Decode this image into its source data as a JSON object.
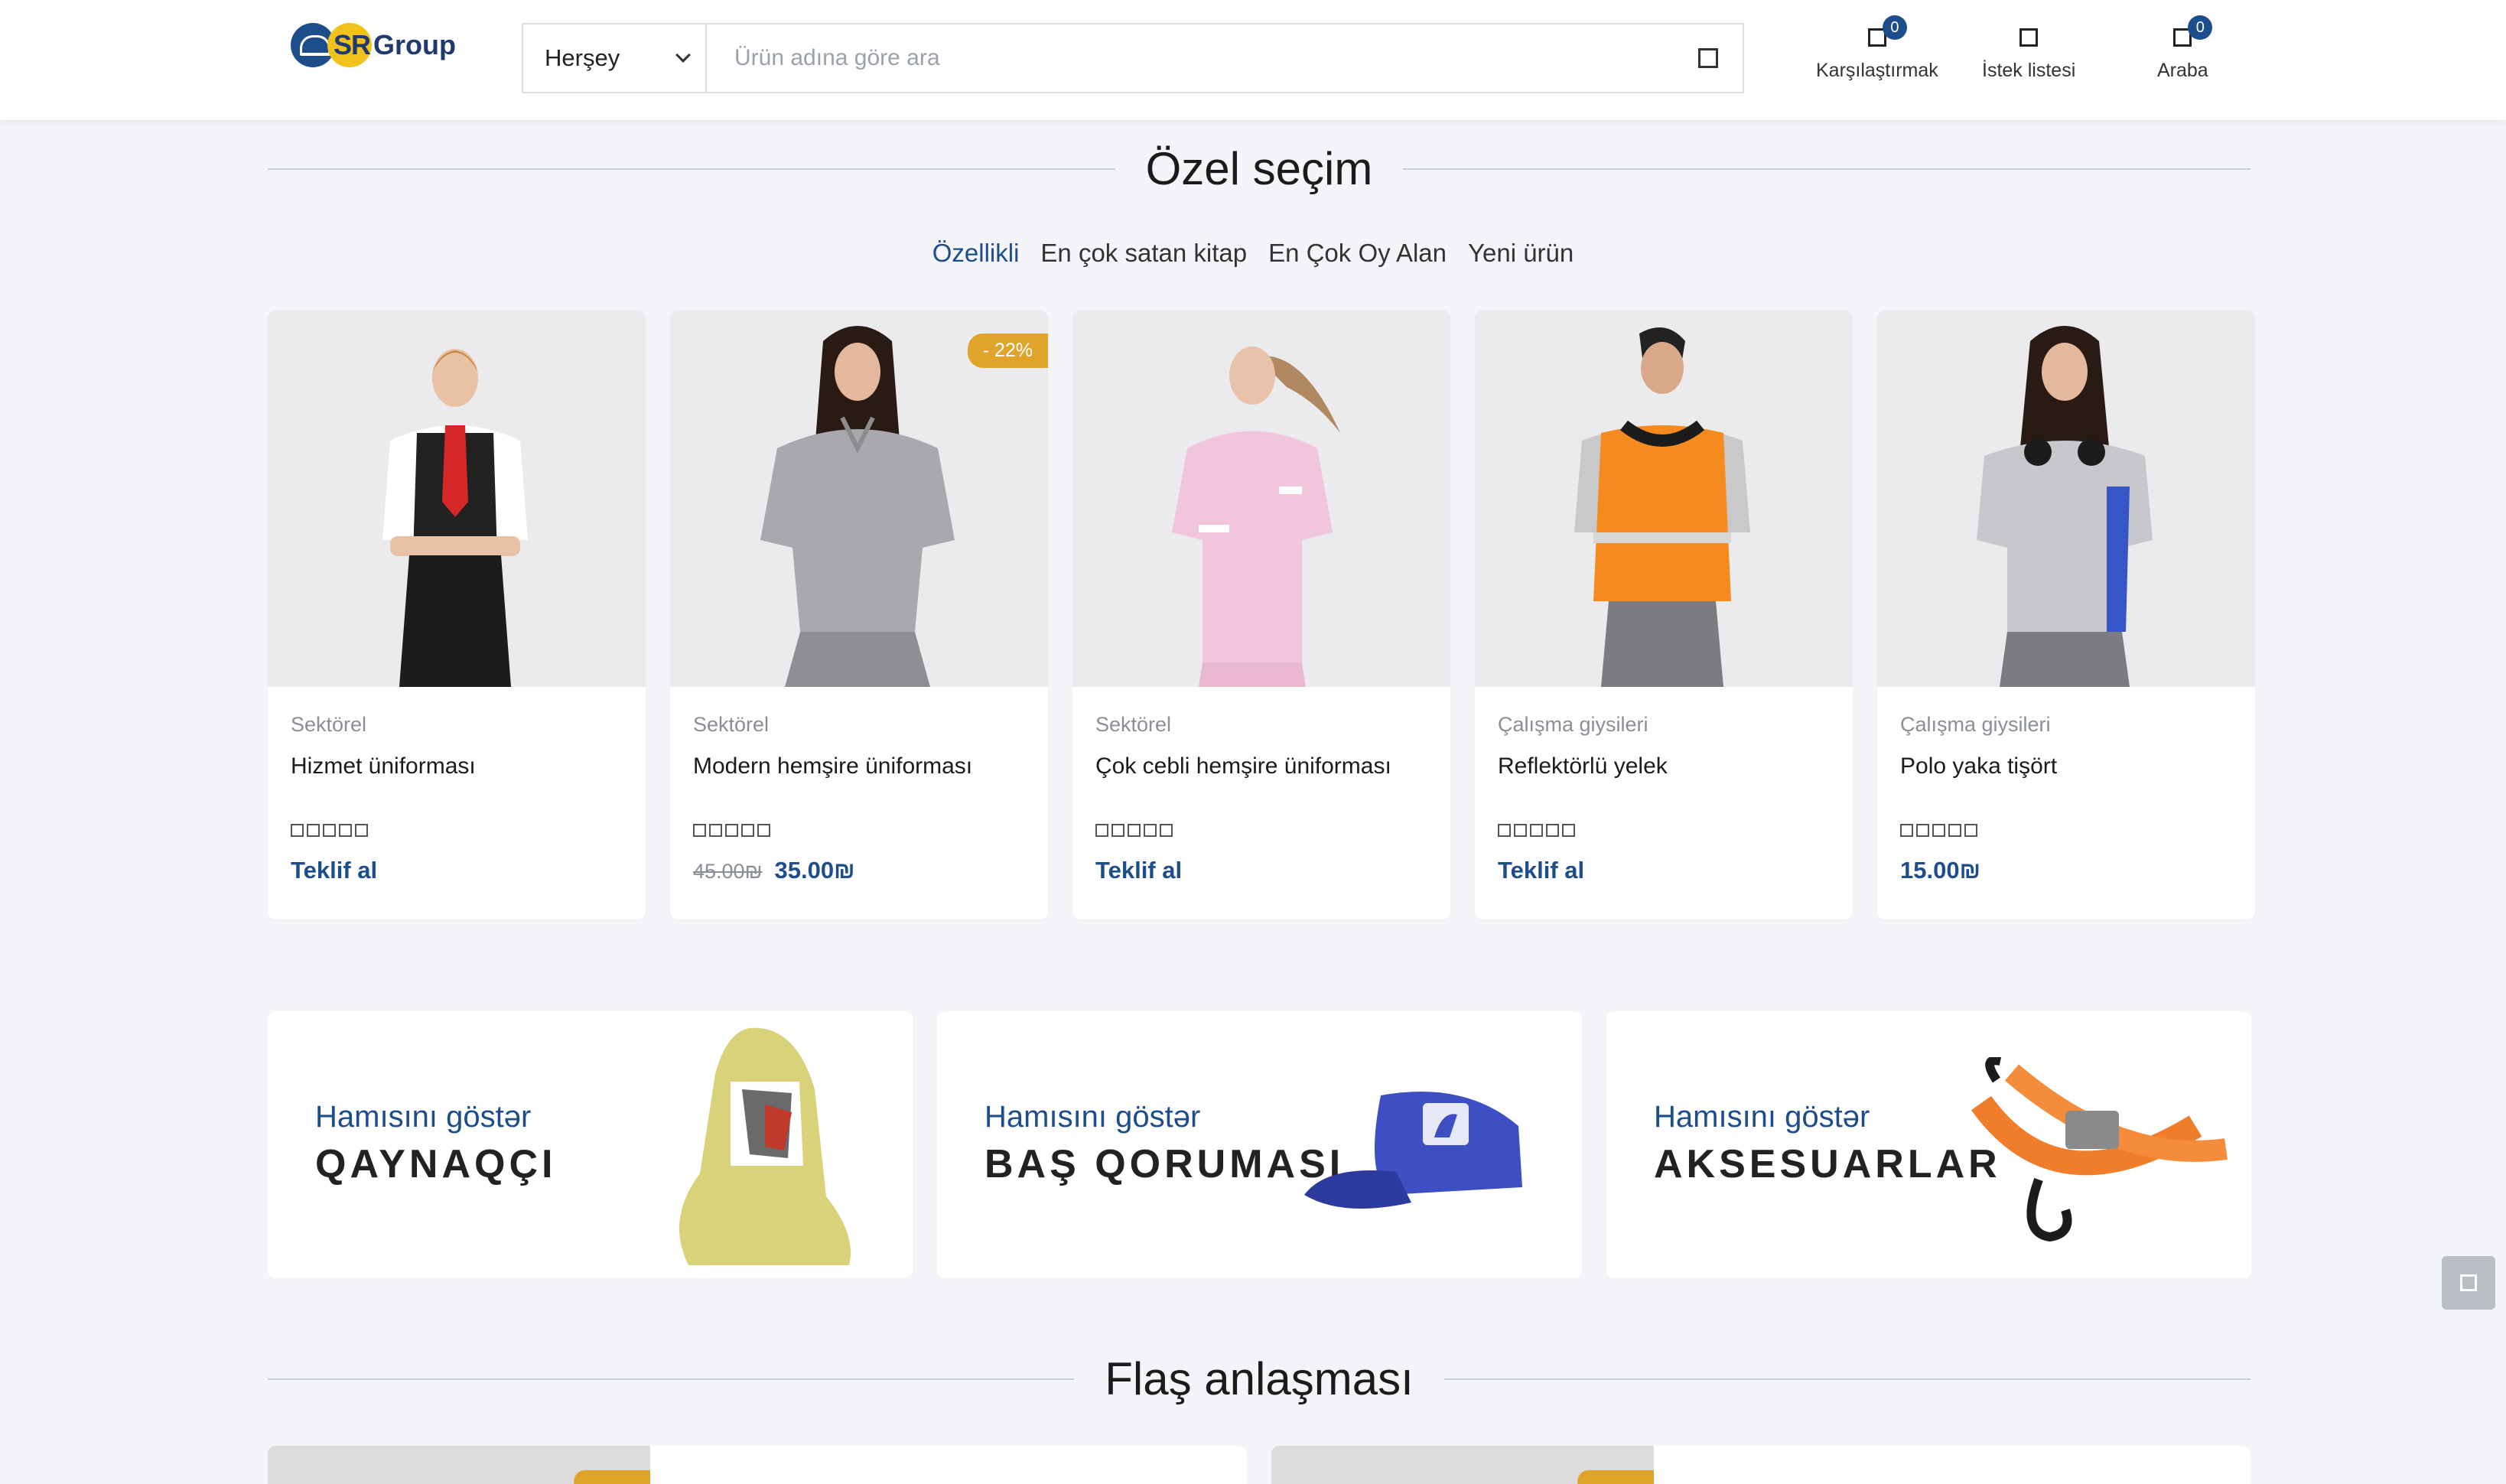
{
  "header": {
    "logo_sr": "SR",
    "logo_group": "Group",
    "search": {
      "category": "Herşey",
      "placeholder": "Ürün adına göre ara",
      "value": ""
    },
    "actions": [
      {
        "label": "Karşılaştırmak",
        "badge": "0"
      },
      {
        "label": "İstek listesi"
      },
      {
        "label": "Araba",
        "badge": "0"
      }
    ]
  },
  "section1": {
    "title": "Özel seçim",
    "tabs": [
      "Özellikli",
      "En çok satan kitap",
      "En Çok Oy Alan",
      "Yeni ürün"
    ],
    "active_tab": "Özellikli"
  },
  "products": [
    {
      "category": "Sektörel",
      "name": "Hizmet üniforması",
      "price_link": "Teklif al",
      "rating": 0
    },
    {
      "category": "Sektörel",
      "name": "Modern hemşire üniforması",
      "sale": "- 22%",
      "old_price": "45.00₪",
      "price": "35.00₪",
      "rating": 0
    },
    {
      "category": "Sektörel",
      "name": "Çok cebli hemşire üniforması",
      "price_link": "Teklif al",
      "rating": 0
    },
    {
      "category": "Çalışma giysileri",
      "name": "Reflektörlü yelek",
      "price_link": "Teklif al",
      "rating": 0
    },
    {
      "category": "Çalışma giysileri",
      "name": "Polo yaka tişört",
      "price": "15.00₪",
      "rating": 0
    }
  ],
  "banners": [
    {
      "sub": "Hamısını göstər",
      "title": "QAYNAQÇI"
    },
    {
      "sub": "Hamısını göstər",
      "title": "BAŞ QORUMASI"
    },
    {
      "sub": "Hamısını göstər",
      "title": "AKSESUARLAR"
    }
  ],
  "section2": {
    "title": "Flaş anlaşması"
  },
  "colors": {
    "brand": "#1e4d8c",
    "sale": "#e0a42b",
    "background": "#f3f5f8"
  }
}
